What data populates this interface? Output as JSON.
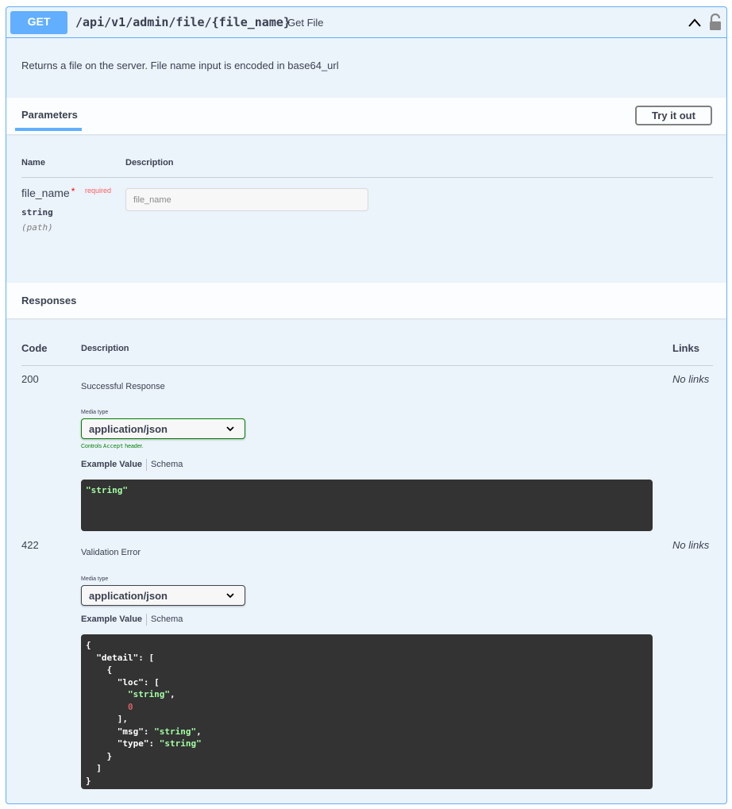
{
  "summary": {
    "method": "GET",
    "path": "/api/v1/admin/file/{file_name}",
    "summary_text": "Get File"
  },
  "description": "Returns a file on the server. File name input is encoded in base64_url",
  "parameters": {
    "tab_label": "Parameters",
    "try_it_out": "Try it out",
    "col_name": "Name",
    "col_description": "Description",
    "items": [
      {
        "name": "file_name",
        "required_mark": "*",
        "required_label": "required",
        "type": "string",
        "in": "(path)",
        "placeholder": "file_name"
      }
    ]
  },
  "responses": {
    "title": "Responses",
    "col_code": "Code",
    "col_description": "Description",
    "col_links": "Links",
    "items": [
      {
        "code": "200",
        "description": "Successful Response",
        "links": "No links",
        "media_type_label": "Media type",
        "media_type": "application/json",
        "controls_prefix": "Controls ",
        "controls_code": "Accept",
        "controls_suffix": " header.",
        "example_tab": "Example Value",
        "schema_tab": "Schema"
      },
      {
        "code": "422",
        "description": "Validation Error",
        "links": "No links",
        "media_type_label": "Media type",
        "media_type": "application/json",
        "example_tab": "Example Value",
        "schema_tab": "Schema"
      }
    ]
  },
  "example_200": {
    "value": "\"string\""
  },
  "example_422": {
    "l1": "{",
    "l2_key": "\"detail\"",
    "l2_rest": ": [",
    "l3": "{",
    "l4_key": "\"loc\"",
    "l4_rest": ": [",
    "l5_val": "\"string\"",
    "l5_rest": ",",
    "l6_val": "0",
    "l7": "],",
    "l8_key": "\"msg\"",
    "l8_sep": ": ",
    "l8_val": "\"string\"",
    "l8_rest": ",",
    "l9_key": "\"type\"",
    "l9_sep": ": ",
    "l9_val": "\"string\"",
    "l10": "}",
    "l11": "]",
    "l12": "}"
  },
  "colors": {
    "get_blue": "#61affe",
    "block_bg": "#ebf3fb",
    "code_bg": "#333333",
    "string_green": "#a2fca2",
    "number_red": "#d36363",
    "required_red": "#ff6060"
  },
  "icons": [
    "chevron-up-icon",
    "lock-icon",
    "chevron-down-icon"
  ]
}
